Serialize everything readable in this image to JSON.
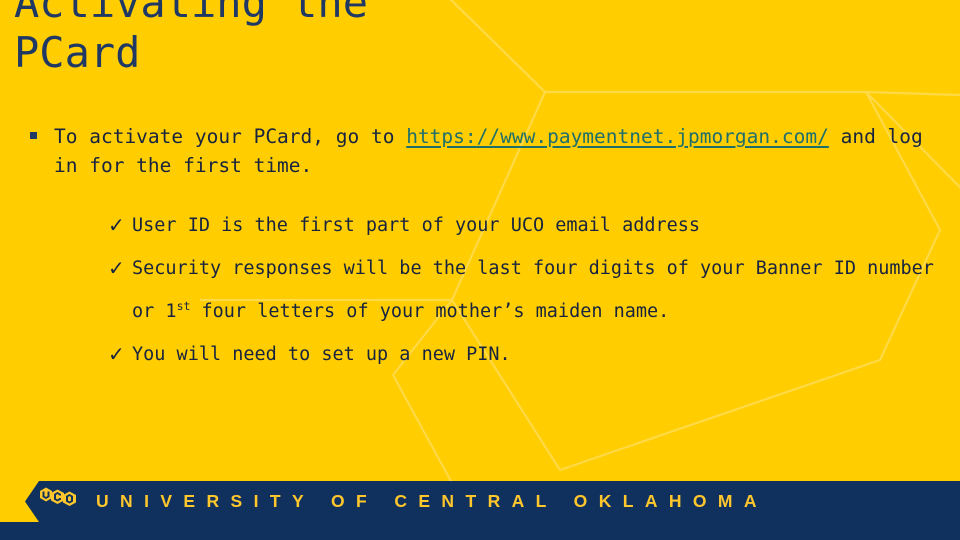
{
  "slide": {
    "background_color": "#FFCD00",
    "navy_color": "#1F3864",
    "link_color": "#1F6F6B",
    "logo_gold": "#FFC72C",
    "title": "Activating the\nPCard"
  },
  "content": {
    "bullet_glyph": "square-bullet",
    "paragraph": {
      "before_link": "To activate your PCard, go to ",
      "link_text": "https://www.paymentnet.jpmorgan.com/",
      "after_link": " and log in for the first time."
    },
    "sub_bullet_glyph": "✓",
    "sub_bullets": [
      {
        "text_before": "User ID is the first part of your UCO email address",
        "sup": "",
        "text_after": ""
      },
      {
        "text_before": "Security responses will be the last four digits of your Banner ID number or 1",
        "sup": "st",
        "text_after": " four letters of your mother’s maiden name."
      },
      {
        "text_before": "You will need to set up a new PIN.",
        "sup": "",
        "text_after": ""
      }
    ]
  },
  "footer": {
    "logo_name": "uco-hexagon-logo",
    "logo_text": "UCO",
    "banner_text": "UNIVERSITY  OF  CENTRAL  OKLAHOMA"
  }
}
